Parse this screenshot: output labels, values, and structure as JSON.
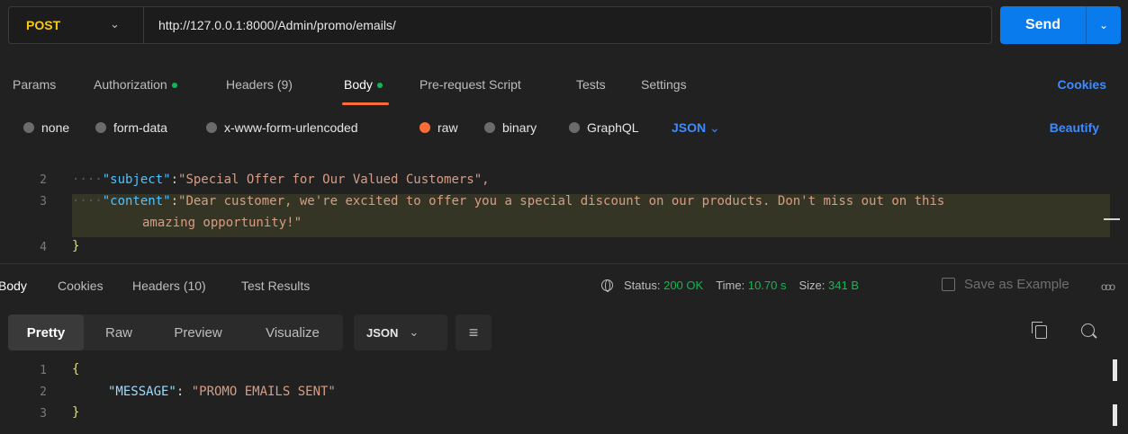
{
  "request": {
    "method": "POST",
    "url": "http://127.0.0.1:8000/Admin/promo/emails/",
    "send_label": "Send"
  },
  "request_tabs": {
    "params": "Params",
    "authorization": "Authorization",
    "headers_label": "Headers",
    "headers_count": "(9)",
    "body": "Body",
    "pre_request_script": "Pre-request Script",
    "tests": "Tests",
    "settings": "Settings",
    "cookies": "Cookies"
  },
  "body_types": {
    "none": "none",
    "form_data": "form-data",
    "urlencoded": "x-www-form-urlencoded",
    "raw": "raw",
    "binary": "binary",
    "graphql": "GraphQL",
    "selected_format": "JSON",
    "beautify": "Beautify"
  },
  "request_editor": {
    "lines": [
      {
        "number": "2",
        "key": "\"subject\"",
        "value": "\"Special Offer for Our Valued Customers\","
      },
      {
        "number": "3",
        "key": "\"content\"",
        "value": "\"Dear customer, we're excited to offer you a special discount on our products. Don't miss out on this",
        "continuation": "amazing opportunity!\""
      },
      {
        "number": "4",
        "brace": "}"
      }
    ]
  },
  "response_tabs": {
    "body": "Body",
    "cookies": "Cookies",
    "headers_label": "Headers",
    "headers_count": "(10)",
    "test_results": "Test Results"
  },
  "response_status": {
    "status_label": "Status:",
    "status_value": "200 OK",
    "time_label": "Time:",
    "time_value": "10.70 s",
    "size_label": "Size:",
    "size_value": "341 B",
    "save_as_example": "Save as Example",
    "more": "ooo"
  },
  "response_view": {
    "pretty": "Pretty",
    "raw": "Raw",
    "preview": "Preview",
    "visualize": "Visualize",
    "format": "JSON"
  },
  "response_body": {
    "line1": "1",
    "line2": "2",
    "line3": "3",
    "open_brace": "{",
    "key": "\"MESSAGE\"",
    "colon": ": ",
    "value": "\"PROMO EMAILS SENT\"",
    "close_brace": "}"
  },
  "colors": {
    "accent_blue": "#097bed",
    "method_yellow": "#f7ca18",
    "tab_underline": "#ff6c37",
    "status_green": "#0cbb52"
  }
}
